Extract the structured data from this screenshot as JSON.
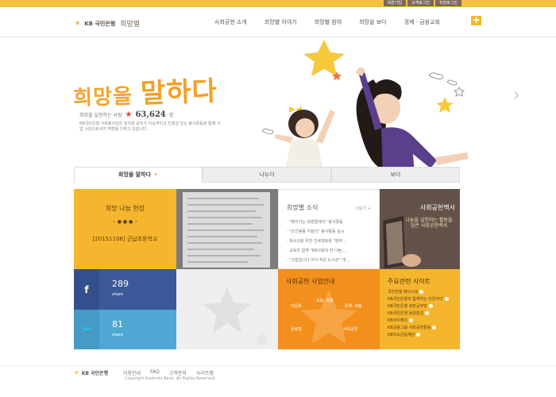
{
  "util_links": [
    "회원가입",
    "고객로그인",
    "직원로그인"
  ],
  "header": {
    "logo_brand": "KB 국민은행",
    "logo_sub": "희망별",
    "nav": [
      "사회공헌 소개",
      "희망별 이야기",
      "희망별 참여",
      "희망을 보다",
      "경제 · 금융교육"
    ],
    "plus": "+"
  },
  "hero": {
    "title_small": "희망을 ",
    "title_big": "말하다",
    "counter_label": "희망을 실천하는 사람",
    "counter_value": "63,624",
    "counter_unit": "명",
    "desc": "KB국민은행 사회봉사단은 임직원 모두가 지속적이고 진정성 있는 봉사활동을 통해 기업 시민으로서의 역할을 다하고 있습니다.",
    "next_arrow": "›"
  },
  "tabs": [
    "희망을 말하다",
    "나누다",
    "보다"
  ],
  "tiles": {
    "field": {
      "title": "희망 나눔 현장",
      "item": "[20151106] 군납초등학교"
    },
    "news": {
      "title": "희망별 소식",
      "more": "더보기 +",
      "items": [
        "\"찾아가는 희망릴레이\" 봉사활동",
        "\"조선봉종 지킴이\" 봉사활동 실시",
        "청소년을 위한 진로멘토링 \"분무...",
        "교육과 함께 \"KB사랑의 한 나눔,...",
        "\"고맙습니다 이식 작은 도서관\" 개..."
      ]
    },
    "whitepaper": {
      "title": "사회공헌백서",
      "desc": "나눔을 실천하는 활동을 담은 사회공헌백서"
    },
    "facebook": {
      "count": "289",
      "label": "share"
    },
    "twitter": {
      "count": "81",
      "label": "share"
    },
    "program": {
      "title": "사회공헌 사업안내",
      "items": [
        "교육, 학술",
        "다문화",
        "문화, 예술",
        "글로벌",
        "사회공헌"
      ]
    },
    "related": {
      "title": "주요관련 사이트",
      "items": [
        "국민은행 페이스북",
        "KB국민은행과 함께하는 라온아띠",
        "KB국민은행 희망공부방",
        "KB국민은행 동양홍걸",
        "KB아이해피",
        "KB금융그룹 사회공헌활동",
        "KB미소금융재단"
      ]
    }
  },
  "footer": {
    "logo": "KB 국민은행",
    "links": [
      "이용안내",
      "FAQ",
      "고객문의",
      "사이트맵"
    ],
    "copyright": "Copyright Kookmin Bank. All Rights Reserved."
  }
}
